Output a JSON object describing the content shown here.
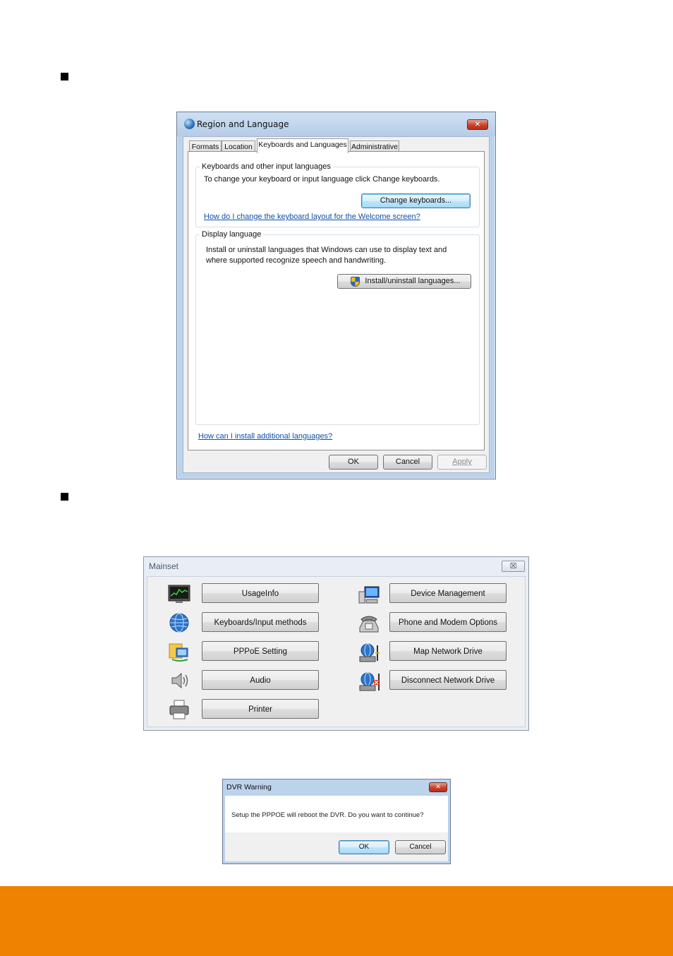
{
  "region_dialog": {
    "title": "Region and Language",
    "close_label": "✕",
    "tabs": [
      "Formats",
      "Location",
      "Keyboards and Languages",
      "Administrative"
    ],
    "keyboards_group": {
      "legend": "Keyboards and other input languages",
      "description": "To change your keyboard or input language click Change keyboards.",
      "change_button": "Change keyboards...",
      "welcome_link": "How do I change the keyboard layout for the Welcome screen?"
    },
    "display_group": {
      "legend": "Display language",
      "description_line1": "Install or uninstall languages that Windows can use to display text and",
      "description_line2": "where supported recognize speech and handwriting.",
      "install_button": "Install/uninstall languages..."
    },
    "additional_link": "How can I install additional languages?",
    "ok": "OK",
    "cancel": "Cancel",
    "apply": "Apply"
  },
  "mainset": {
    "title": "Mainset",
    "close_label": "☒",
    "left_items": [
      {
        "label": "UsageInfo",
        "icon": "monitor-graph-icon"
      },
      {
        "label": "Keyboards/Input methods",
        "icon": "globe-icon"
      },
      {
        "label": "PPPoE Setting",
        "icon": "network-folder-icon"
      },
      {
        "label": "Audio",
        "icon": "speaker-icon"
      },
      {
        "label": "Printer",
        "icon": "printer-icon"
      }
    ],
    "right_items": [
      {
        "label": "Device Management",
        "icon": "computer-icon"
      },
      {
        "label": "Phone and Modem Options",
        "icon": "phone-icon"
      },
      {
        "label": "Map Network Drive",
        "icon": "map-drive-icon"
      },
      {
        "label": "Disconnect Network Drive",
        "icon": "disconnect-drive-icon"
      }
    ]
  },
  "dvr_warning": {
    "title": "DVR Warning",
    "close_label": "✕",
    "message": "Setup the PPPOE will reboot the DVR. Do you want to continue?",
    "ok": "OK",
    "cancel": "Cancel"
  },
  "colors": {
    "footer_band": "#ef8300",
    "link": "#0f4fa8",
    "window_frame": "#bcd3ec"
  }
}
